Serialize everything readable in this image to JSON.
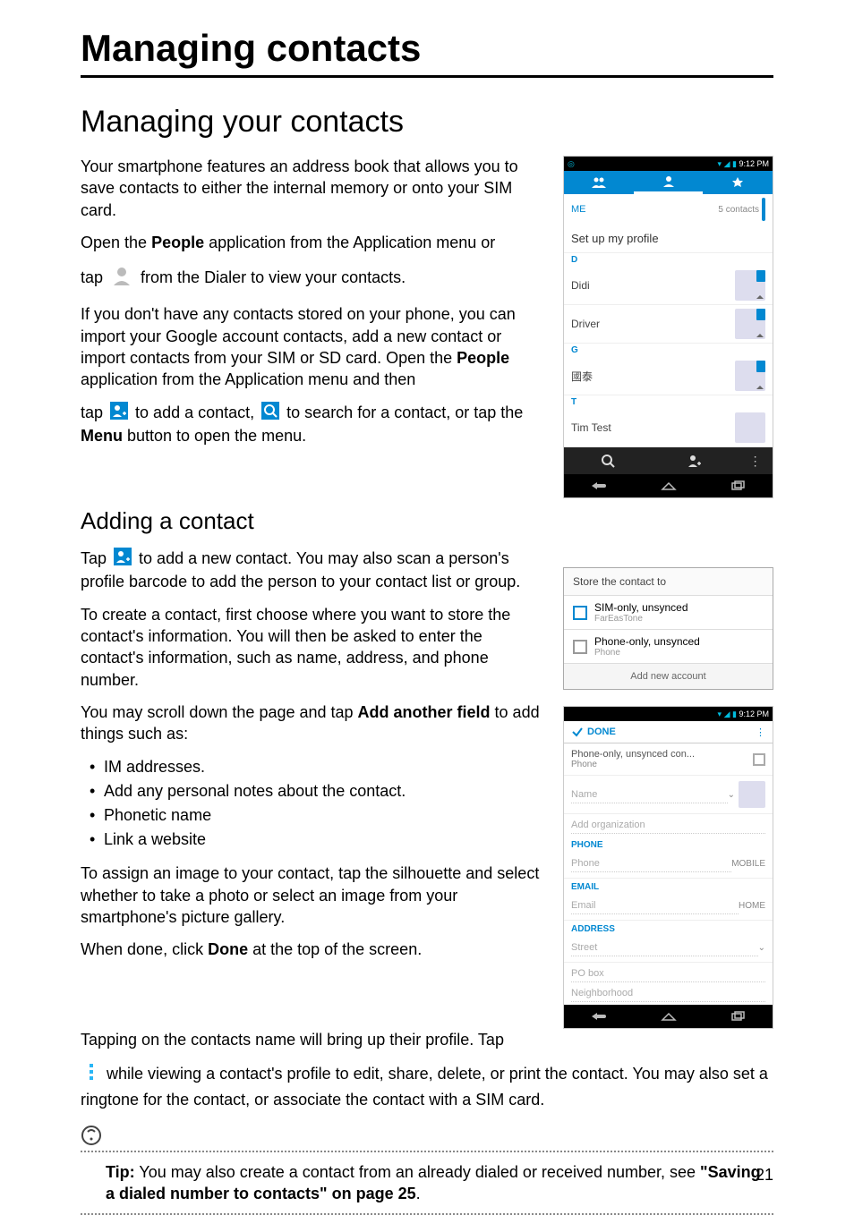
{
  "title": "Managing contacts",
  "section": "Managing your contacts",
  "subsection": "Adding a contact",
  "p1": "Your smartphone features an address book that allows you to save contacts to either the internal memory or onto your SIM card.",
  "p2a": "Open the ",
  "p2b": "People",
  "p2c": " application from the Application menu or",
  "p3a": "tap ",
  "p3b": " from the Dialer to view your contacts.",
  "p4a": "If you don't have any contacts stored on your phone, you can import your Google account contacts, add a new contact or import contacts from your SIM or SD card. Open the ",
  "p4b": "People",
  "p4c": " application from the Application menu and then",
  "p5a": "tap ",
  "p5b": " to add a contact, ",
  "p5c": " to search for a contact, or tap the ",
  "p5d": "Menu",
  "p5e": " button to open the menu.",
  "p6a": "Tap ",
  "p6b": " to add a new contact. You may also scan a person's profile barcode to add the person to your contact list or group.",
  "p7": "To create a contact, first choose where you want to store the contact's information. You will then be asked to enter the contact's information, such as name, address, and phone number.",
  "p8a": "You may scroll down the page and tap ",
  "p8b": "Add another field",
  "p8c": " to add things such as:",
  "bul": [
    "IM addresses.",
    "Add any personal notes about the contact.",
    "Phonetic name",
    "Link a website"
  ],
  "p9": "To assign an image to your contact, tap the silhouette and select whether to take a photo or select an image from your smartphone's picture gallery.",
  "p10a": "When done, click ",
  "p10b": "Done",
  "p10c": " at the top of the screen.",
  "p11": "Tapping on the contacts name will bring up their profile. Tap",
  "p12": " while viewing a contact's profile to edit, share, delete, or print the contact. You may also set a ringtone for the contact, or associate the contact with a SIM card.",
  "tip_label": "Tip:",
  "tip_a": " You may also create a contact from an already dialed or received number, see ",
  "tip_b": "\"Saving a dialed number to contacts\" on page 25",
  "tip_c": ".",
  "page": "21",
  "phone1": {
    "time": "9:12 PM",
    "me": "ME",
    "count": "5 contacts",
    "setup": "Set up my profile",
    "secD": "D",
    "c1": "Didi",
    "c2": "Driver",
    "secG": "G",
    "c3": "國泰",
    "secT": "T",
    "c4": "Tim Test"
  },
  "store": {
    "title": "Store the contact to",
    "o1": "SIM-only, unsynced",
    "o1s": "FarEasTone",
    "o2": "Phone-only, unsynced",
    "o2s": "Phone",
    "add": "Add new account"
  },
  "edit": {
    "time": "9:12 PM",
    "done": "DONE",
    "acct": "Phone-only, unsynced con...",
    "accts": "Phone",
    "name": "Name",
    "org": "Add organization",
    "phoneL": "PHONE",
    "phone": "Phone",
    "phonet": "MOBILE",
    "emailL": "EMAIL",
    "email": "Email",
    "emailt": "HOME",
    "addrL": "ADDRESS",
    "street": "Street",
    "pobox": "PO box",
    "nbh": "Neighborhood"
  }
}
